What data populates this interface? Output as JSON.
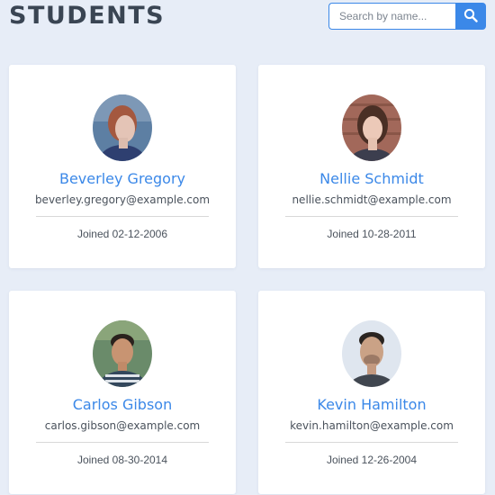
{
  "header": {
    "title": "STUDENTS",
    "search_placeholder": "Search by name...",
    "search_icon": "search-icon",
    "accent_color": "#3b88e8"
  },
  "students": [
    {
      "name": "Beverley Gregory",
      "email": "beverley.gregory@example.com",
      "joined": "Joined 02-12-2006"
    },
    {
      "name": "Nellie Schmidt",
      "email": "nellie.schmidt@example.com",
      "joined": "Joined 10-28-2011"
    },
    {
      "name": "Carlos Gibson",
      "email": "carlos.gibson@example.com",
      "joined": "Joined 08-30-2014"
    },
    {
      "name": "Kevin Hamilton",
      "email": "kevin.hamilton@example.com",
      "joined": "Joined 12-26-2004"
    }
  ]
}
